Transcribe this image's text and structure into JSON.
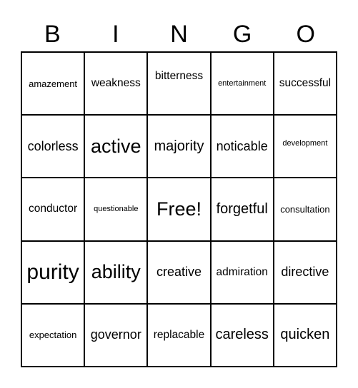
{
  "header": {
    "letters": [
      "B",
      "I",
      "N",
      "G",
      "O"
    ]
  },
  "grid": {
    "rows": [
      [
        "amazement",
        "weakness",
        "bitterness",
        "entertainment",
        "successful"
      ],
      [
        "colorless",
        "active",
        "majority",
        "noticable",
        "development"
      ],
      [
        "conductor",
        "questionable",
        "Free!",
        "forgetful",
        "consultation"
      ],
      [
        "purity",
        "ability",
        "creative",
        "admiration",
        "directive"
      ],
      [
        "expectation",
        "governor",
        "replacable",
        "careless",
        "quicken"
      ]
    ]
  }
}
